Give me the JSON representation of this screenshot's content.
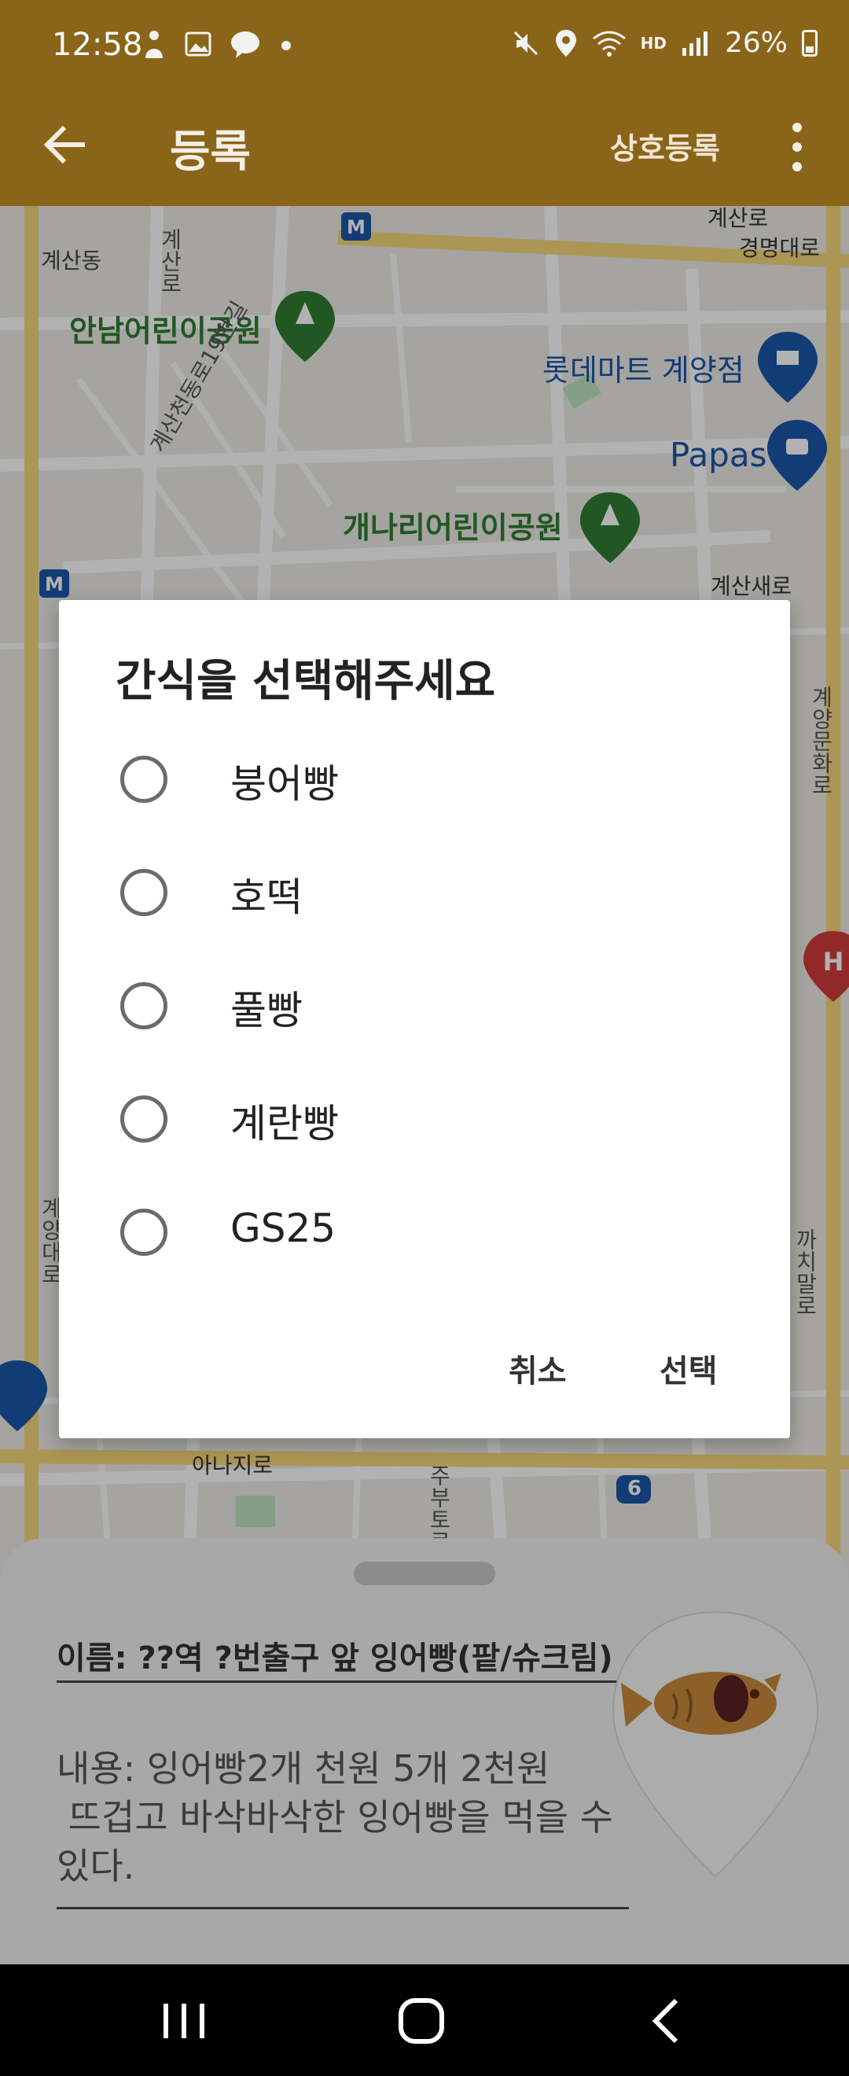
{
  "status_bar": {
    "time": "12:58",
    "left_icons": [
      "person-icon",
      "image-icon",
      "talk-icon",
      "dot-icon"
    ],
    "battery": "26%",
    "hd_label": "HD",
    "colors": {
      "bar": "#8a6419"
    }
  },
  "app_bar": {
    "title": "등록",
    "action_label": "상호등록"
  },
  "map": {
    "labels": [
      {
        "name": "map-label-gyesan-dong",
        "text": "계산동"
      },
      {
        "name": "map-label-anam-park",
        "text": "안남어린이공원"
      },
      {
        "name": "map-label-lotte-mart",
        "text": "롯데마트 계양점"
      },
      {
        "name": "map-label-papas",
        "text": "Papas"
      },
      {
        "name": "map-label-gaenari-park",
        "text": "개나리어린이공원"
      },
      {
        "name": "map-label-gyeongmyeong-daero",
        "text": "경명대로"
      },
      {
        "name": "map-label-gyesancheon-ro",
        "text": "계산천동로19번길"
      },
      {
        "name": "map-label-gyesan-saero",
        "text": "계산새로"
      },
      {
        "name": "map-label-anaji-ro",
        "text": "아나지로"
      },
      {
        "name": "map-label-route-6",
        "text": "6"
      },
      {
        "name": "map-label-gyesan-ro-top",
        "text": "계산로"
      },
      {
        "name": "map-label-gyeyang-munhwa-ro",
        "text": "계양문화로"
      },
      {
        "name": "map-label-gyeyang-daero",
        "text": "계양대로"
      },
      {
        "name": "map-label-kkachi-ro",
        "text": "까치말로"
      },
      {
        "name": "map-label-gyesan-top",
        "text": "계산로"
      },
      {
        "name": "map-label-jubuto-ro",
        "text": "주부토로"
      }
    ],
    "colors": {
      "park_green": "#2e7d32",
      "poi_blue": "#1a56a8",
      "hospital_red": "#d23b3b"
    }
  },
  "dialog": {
    "title": "간식을 선택해주세요",
    "options": [
      "붕어빵",
      "호떡",
      "풀빵",
      "계란빵",
      "GS25"
    ],
    "cancel_label": "취소",
    "confirm_label": "선택"
  },
  "sheet": {
    "name_text": "이름: ??역 ?번출구 앞 잉어빵(팥/슈크림)",
    "content_text": "내용: 잉어빵2개 천원 5개 2천원\n 뜨겁고 바삭바삭한 잉어빵을 먹을 수 있다."
  },
  "nav_bar": {
    "items": [
      "recent-apps-icon",
      "home-icon",
      "back-icon"
    ]
  }
}
